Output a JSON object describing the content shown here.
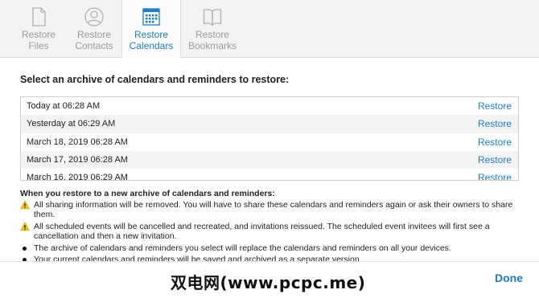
{
  "tabs": [
    {
      "label_line1": "Restore",
      "label_line2": "Files",
      "icon": "file-icon",
      "active": false
    },
    {
      "label_line1": "Restore",
      "label_line2": "Contacts",
      "icon": "contacts-icon",
      "active": false
    },
    {
      "label_line1": "Restore",
      "label_line2": "Calendars",
      "icon": "calendar-icon",
      "active": true
    },
    {
      "label_line1": "Restore",
      "label_line2": "Bookmarks",
      "icon": "book-icon",
      "active": false
    }
  ],
  "main": {
    "title": "Select an archive of calendars and reminders to restore:",
    "archives": [
      {
        "date": "Today at 06:28 AM",
        "action": "Restore"
      },
      {
        "date": "Yesterday at 06:29 AM",
        "action": "Restore"
      },
      {
        "date": "March 18, 2019 06:28 AM",
        "action": "Restore"
      },
      {
        "date": "March 17, 2019 06:28 AM",
        "action": "Restore"
      },
      {
        "date": "March 16, 2019 06:29 AM",
        "action": "Restore"
      }
    ]
  },
  "notes": {
    "heading": "When you restore to a new archive of calendars and reminders:",
    "items": [
      {
        "type": "warning",
        "text": "All sharing information will be removed. You will have to share these calendars and reminders again or ask their owners to share them."
      },
      {
        "type": "warning",
        "text": "All scheduled events will be cancelled and recreated, and invitations reissued. The scheduled event invitees will first see a cancellation and then a new invitation."
      },
      {
        "type": "bullet",
        "text": "The archive of calendars and reminders you select will replace the calendars and reminders on all your devices."
      },
      {
        "type": "bullet",
        "text": "Your current calendars and reminders will be saved and archived as a separate version."
      }
    ]
  },
  "footer": {
    "watermark": "双电网(www.pcpc.me)",
    "done_label": "Done"
  },
  "colors": {
    "accent": "#1a7fd4",
    "warning": "#f2c40f"
  }
}
